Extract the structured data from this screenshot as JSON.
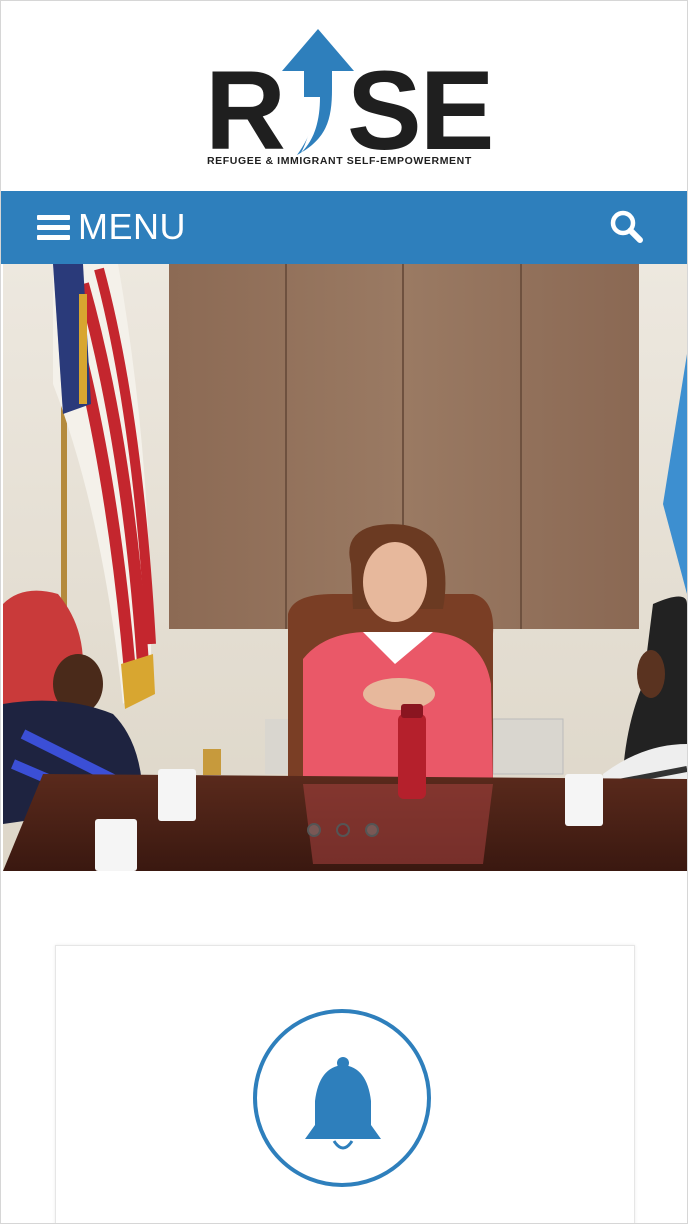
{
  "logo": {
    "letters_left": "R",
    "letters_right": "SE",
    "tagline": "REFUGEE & IMMIGRANT SELF-EMPOWERMENT",
    "arrow_color": "#2e7fbc"
  },
  "nav": {
    "menu_label": "MENU",
    "menu_icon": "hamburger-icon",
    "search_icon": "search-icon",
    "bar_color": "#2e7fbc"
  },
  "slider": {
    "slide_count": 3,
    "active_index": 1
  },
  "card": {
    "icon": "bell-icon",
    "accent_color": "#2e7fbc"
  }
}
